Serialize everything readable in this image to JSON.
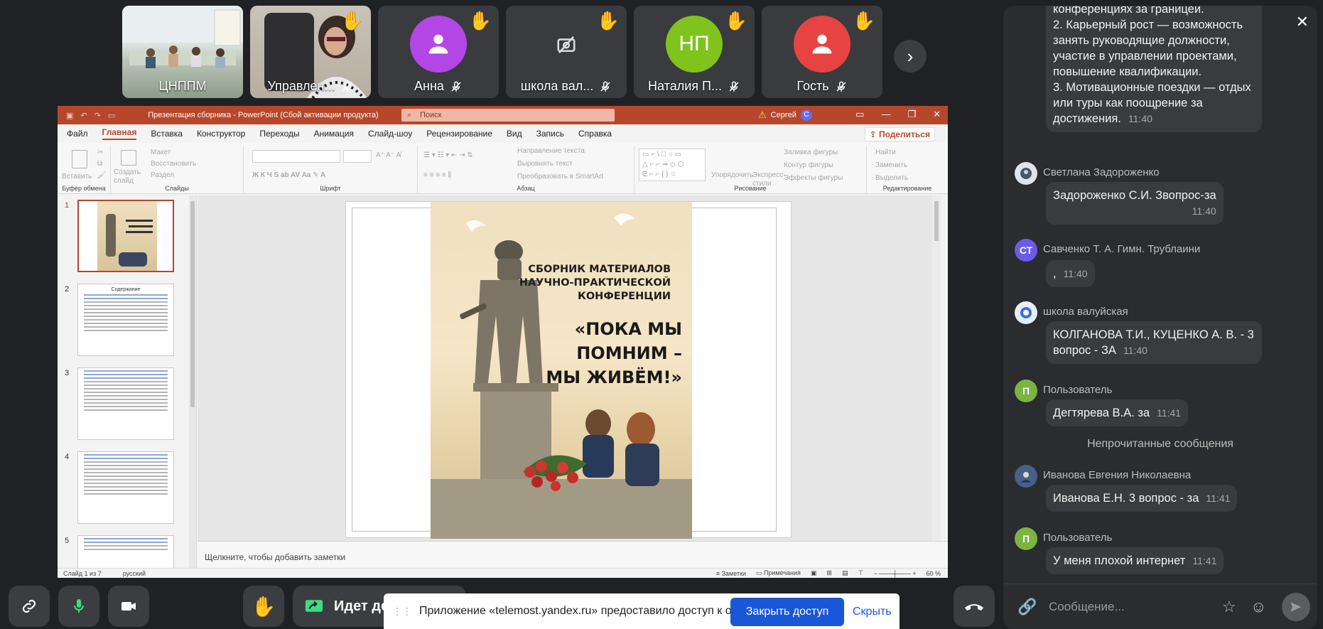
{
  "participants": [
    {
      "name": "ЦНППМ",
      "muted": false,
      "hand": false,
      "kind": "video-room"
    },
    {
      "name": "Управлен...",
      "muted": true,
      "hand": true,
      "kind": "video-person"
    },
    {
      "name": "Анна",
      "muted": true,
      "hand": true,
      "kind": "avatar",
      "color": "#b347e6"
    },
    {
      "name": "школа вал...",
      "muted": true,
      "hand": true,
      "kind": "camera-off"
    },
    {
      "name": "Наталия П...",
      "muted": true,
      "hand": true,
      "kind": "initials",
      "initials": "НП",
      "color": "#7fc31c"
    },
    {
      "name": "Гость",
      "muted": true,
      "hand": true,
      "kind": "avatar",
      "color": "#e84343"
    }
  ],
  "ppt": {
    "title": "Презентация сборника  -  PowerPoint (Сбой активации продукта)",
    "search_placeholder": "Поиск",
    "user": "Сергей",
    "user_initial": "С",
    "menu": [
      "Файл",
      "Главная",
      "Вставка",
      "Конструктор",
      "Переходы",
      "Анимация",
      "Слайд-шоу",
      "Рецензирование",
      "Вид",
      "Запись",
      "Справка"
    ],
    "share_label": "Поделиться",
    "ribbon_groups": [
      "Буфер обмена",
      "Слайды",
      "Шрифт",
      "Абзац",
      "Рисование",
      "Редактирование"
    ],
    "ribbon_buttons": {
      "paste": "Вставить",
      "create_slide": "Создать слайд",
      "layout": "Макет",
      "restore": "Восстановить",
      "section": "Раздел",
      "text_direction": "Направление текста",
      "align_text": "Выровнять текст",
      "smartart": "Преобразовать в SmartArt",
      "arrange": "Упорядочить",
      "quick_styles": "Экспресс-стили",
      "shape_fill": "Заливка фигуры",
      "shape_outline": "Контур фигуры",
      "shape_effects": "Эффекты фигуры",
      "find": "Найти",
      "replace": "Заменить",
      "select": "Выделить"
    },
    "slide_numbers": [
      "1",
      "2",
      "3",
      "4",
      "5"
    ],
    "thumb2_heading": "Содержание",
    "cover_subtitle": "СБОРНИК МАТЕРИАЛОВ НАУЧНО-ПРАКТИЧЕСКОЙ КОНФЕРЕНЦИИ",
    "cover_subtitle_lines": [
      "СБОРНИК МАТЕРИАЛОВ",
      "НАУЧНО-ПРАКТИЧЕСКОЙ",
      "КОНФЕРЕНЦИИ"
    ],
    "cover_title_lines": [
      "«ПОКА МЫ",
      "ПОМНИМ –",
      "МЫ ЖИВЁМ!»"
    ],
    "notes_placeholder": "Щелкните, чтобы добавить заметки",
    "status_slide": "Слайд 1 из 7",
    "status_lang": "русский",
    "status_notes": "Заметки",
    "status_comments": "Примечания",
    "zoom": "60 %"
  },
  "controls": {
    "screen_share_label": "Идет де"
  },
  "notice": {
    "text": "Приложение «telemost.yandex.ru» предоставило доступ к окну.",
    "stop_label": "Закрыть доступ",
    "hide_label": "Скрыть"
  },
  "chat": {
    "messages_top": [
      "конференциях за границей.",
      "2.      Карьерный рост — возможность занять руководящие должности, участие в управлении проектами, повышение квалификации.",
      "3.      Мотивационные поездки — отдых или туры как поощрение за достижения."
    ],
    "top_time": "11:40",
    "messages": [
      {
        "sender": "Светлана Задороженко",
        "text": "Задороженко С.И. Звопрос-за",
        "time": "11:40",
        "avatar": "img",
        "color": "#dfe3ea"
      },
      {
        "sender": "Савченко Т. А. Гимн. Трублаини",
        "text": ",",
        "time": "11:40",
        "avatar": "СТ",
        "color": "#6b5ce7"
      },
      {
        "sender": "школа валуйская",
        "text": "КОЛГАНОВА Т.И., КУЦЕНКО А. В. - 3 вопрос - ЗА",
        "time": "11:40",
        "avatar": "img",
        "color": "#e4eefc"
      },
      {
        "sender": "Пользователь",
        "text": "Дегтярева В.А.  за",
        "time": "11:41",
        "avatar": "П",
        "color": "#7cb342"
      }
    ],
    "unread_label": "Непрочитанные сообщения",
    "messages_after": [
      {
        "sender": "Иванова Евгения Николаевна",
        "text": "Иванова Е.Н. 3 вопрос - за",
        "time": "11:41",
        "avatar": "img",
        "color": "#47618c"
      },
      {
        "sender": "Пользователь",
        "text": "У меня плохой интернет",
        "time": "11:41",
        "avatar": "П",
        "color": "#7cb342"
      }
    ],
    "composer_placeholder": "Сообщение..."
  }
}
